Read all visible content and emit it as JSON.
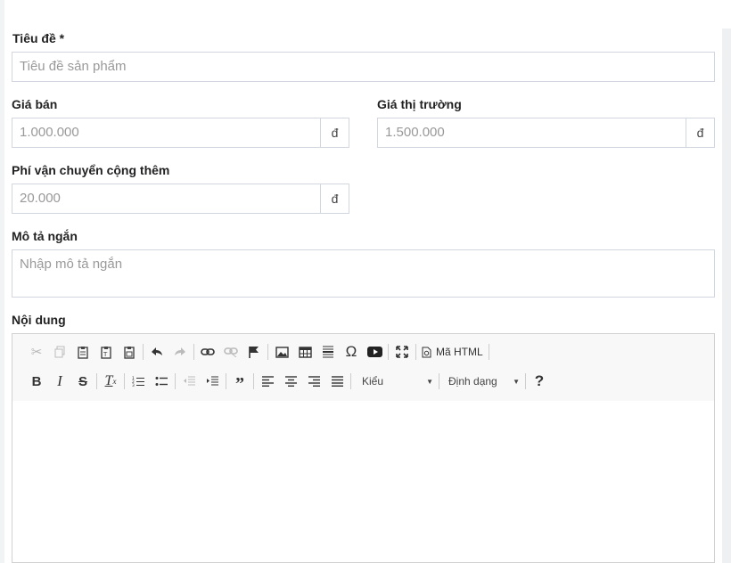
{
  "form": {
    "title_label": "Tiêu đề *",
    "title_placeholder": "Tiêu đề sản phẩm",
    "price_label": "Giá bán",
    "price_placeholder": "1.000.000",
    "market_price_label": "Giá thị trường",
    "market_price_placeholder": "1.500.000",
    "shipping_label": "Phí vận chuyển cộng thêm",
    "shipping_placeholder": "20.000",
    "currency": "đ",
    "short_desc_label": "Mô tả ngắn",
    "short_desc_placeholder": "Nhập mô tả ngắn",
    "content_label": "Nội dung"
  },
  "editor": {
    "source_label": "Mã HTML",
    "styles_label": "Kiểu",
    "format_label": "Định dạng",
    "help_label": "?",
    "icons": [
      "cut-icon",
      "copy-icon",
      "paste-icon",
      "paste-text-icon",
      "paste-word-icon",
      "undo-icon",
      "redo-icon",
      "link-icon",
      "unlink-icon",
      "anchor-icon",
      "image-icon",
      "table-icon",
      "horizontal-line-icon",
      "special-char-icon",
      "youtube-icon",
      "maximize-icon",
      "source-icon",
      "bold-icon",
      "italic-icon",
      "strike-icon",
      "remove-format-icon",
      "numbered-list-icon",
      "bulleted-list-icon",
      "outdent-icon",
      "indent-icon",
      "blockquote-icon",
      "align-left-icon",
      "align-center-icon",
      "align-right-icon",
      "justify-icon",
      "dropdown-arrow-icon"
    ]
  }
}
